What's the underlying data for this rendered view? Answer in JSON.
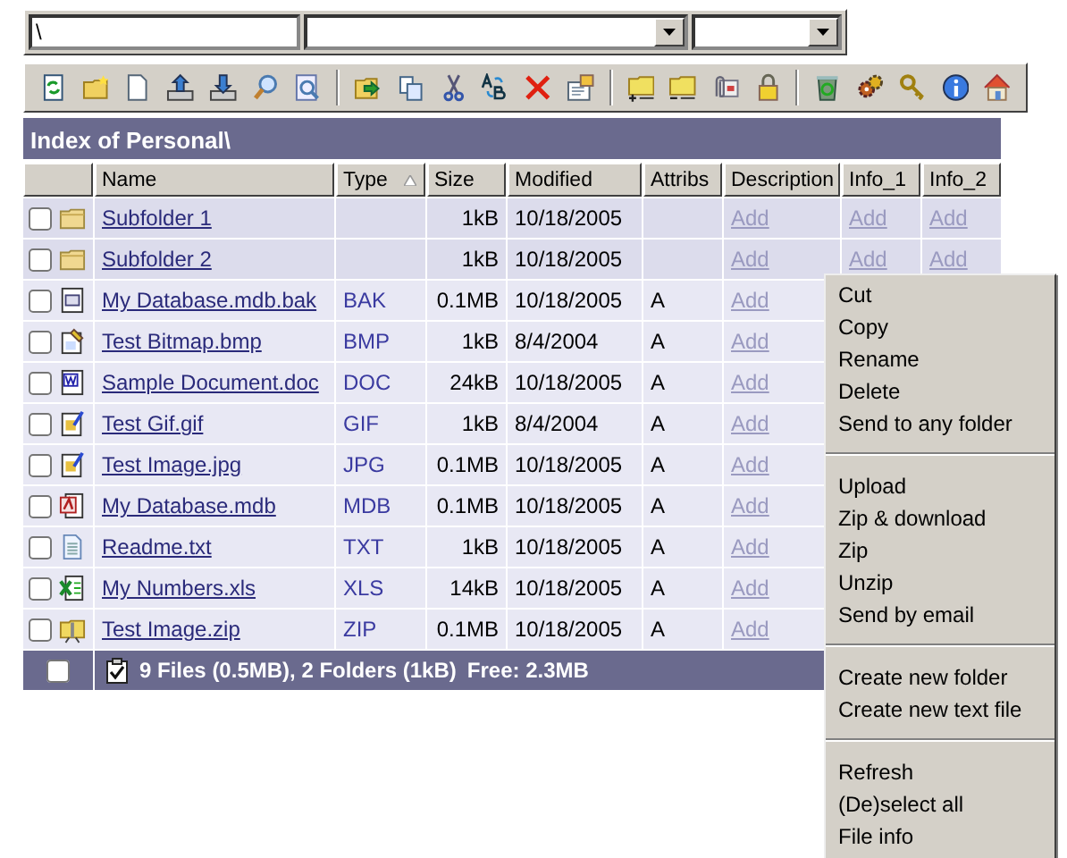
{
  "address_bar": {
    "path": "\\"
  },
  "title": "Index of Personal\\",
  "columns": [
    {
      "label": "Name",
      "sorted": false
    },
    {
      "label": "Type",
      "sorted": true
    },
    {
      "label": "Size",
      "sorted": false
    },
    {
      "label": "Modified",
      "sorted": false
    },
    {
      "label": "Attribs",
      "sorted": false
    },
    {
      "label": "Description",
      "sorted": false
    },
    {
      "label": "Info_1",
      "sorted": false
    },
    {
      "label": "Info_2",
      "sorted": false
    }
  ],
  "rows": [
    {
      "kind": "folder",
      "checked": false,
      "name": "Subfolder 1",
      "size": "1kB",
      "modified": "10/18/2005",
      "description": "Add",
      "info_1": "Add",
      "info_2": "Add"
    },
    {
      "kind": "folder",
      "checked": false,
      "name": "Subfolder 2",
      "size": "1kB",
      "modified": "10/18/2005",
      "description": "Add",
      "info_1": "Add",
      "info_2": "Add"
    },
    {
      "kind": "backup",
      "checked": false,
      "name": "My Database.mdb.bak",
      "type": "BAK",
      "size": "0.1MB",
      "modified": "10/18/2005",
      "attribs": "A",
      "description": "Add"
    },
    {
      "kind": "bitmap",
      "checked": false,
      "name": "Test Bitmap.bmp",
      "type": "BMP",
      "size": "1kB",
      "modified": "8/4/2004",
      "attribs": "A",
      "description": "Add"
    },
    {
      "kind": "word",
      "checked": false,
      "name": "Sample Document.doc",
      "type": "DOC",
      "size": "24kB",
      "modified": "10/18/2005",
      "attribs": "A",
      "description": "Add"
    },
    {
      "kind": "image",
      "checked": false,
      "name": "Test Gif.gif",
      "type": "GIF",
      "size": "1kB",
      "modified": "8/4/2004",
      "attribs": "A",
      "description": "Add"
    },
    {
      "kind": "image",
      "checked": false,
      "name": "Test Image.jpg",
      "type": "JPG",
      "size": "0.1MB",
      "modified": "10/18/2005",
      "attribs": "A",
      "description": "Add"
    },
    {
      "kind": "access",
      "checked": false,
      "name": "My Database.mdb",
      "type": "MDB",
      "size": "0.1MB",
      "modified": "10/18/2005",
      "attribs": "A",
      "description": "Add"
    },
    {
      "kind": "text",
      "checked": false,
      "name": "Readme.txt",
      "type": "TXT",
      "size": "1kB",
      "modified": "10/18/2005",
      "attribs": "A",
      "description": "Add"
    },
    {
      "kind": "excel",
      "checked": false,
      "name": "My Numbers.xls",
      "type": "XLS",
      "size": "14kB",
      "modified": "10/18/2005",
      "attribs": "A",
      "description": "Add"
    },
    {
      "kind": "zip",
      "checked": false,
      "name": "Test Image.zip",
      "type": "ZIP",
      "size": "0.1MB",
      "modified": "10/18/2005",
      "attribs": "A",
      "description": "Add"
    }
  ],
  "footer": {
    "checked": false,
    "summary": "9 Files (0.5MB), 2 Folders (1kB)",
    "free": "Free: 2.3MB"
  },
  "context_menu": {
    "groups": [
      [
        "Cut",
        "Copy",
        "Rename",
        "Delete",
        "Send to any folder"
      ],
      [
        "Upload",
        "Zip & download",
        "Zip",
        "Unzip",
        "Send by email"
      ],
      [
        "Create new folder",
        "Create new text file"
      ],
      [
        "Refresh",
        "(De)select all",
        "File info"
      ]
    ]
  }
}
